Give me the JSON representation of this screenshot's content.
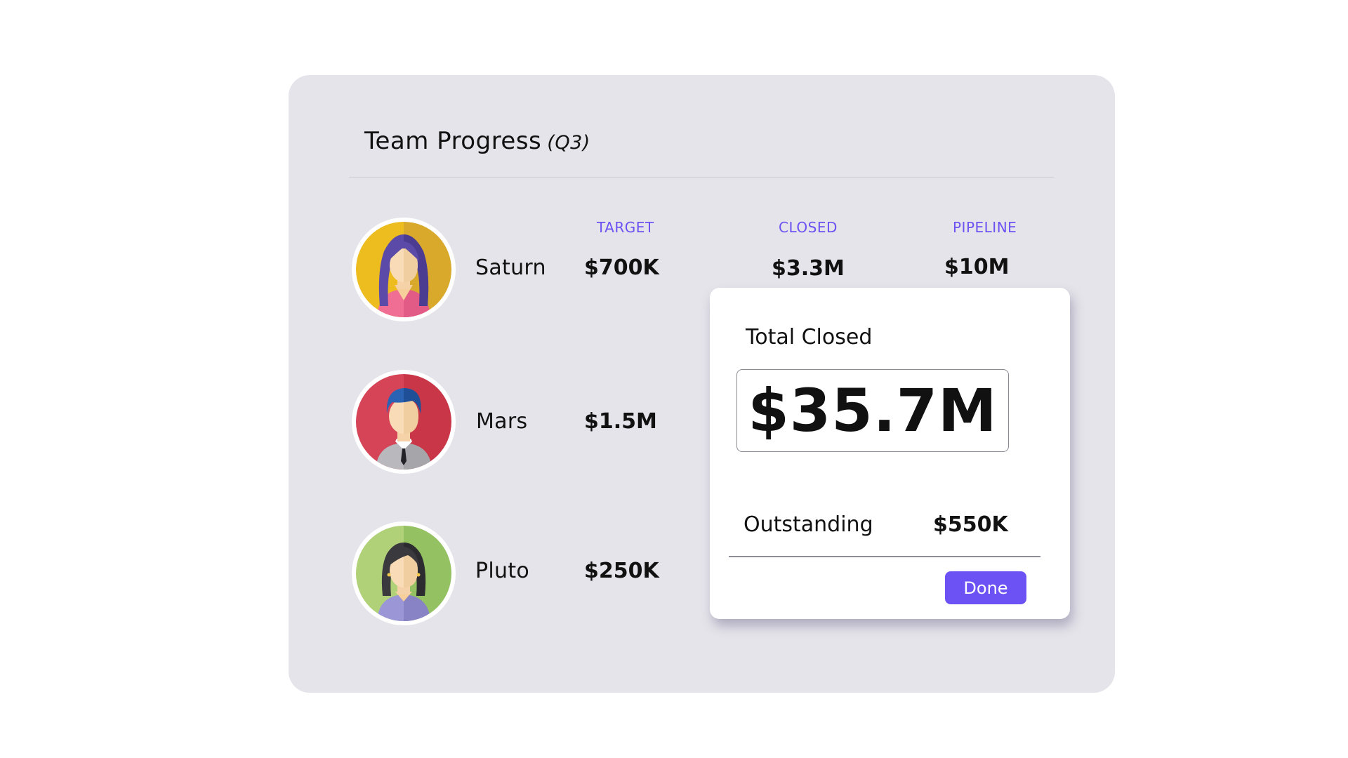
{
  "header": {
    "title": "Team Progress",
    "quarter": "(Q3)"
  },
  "columns": {
    "target": "TARGET",
    "closed": "CLOSED",
    "pipeline": "PIPELINE"
  },
  "members": [
    {
      "name": "Saturn",
      "target": "$700K",
      "closed": "$3.3M",
      "pipeline": "$10M",
      "avatar": "woman-avatar-icon",
      "avatar_color": "#e8b61e"
    },
    {
      "name": "Mars",
      "target": "$1.5M",
      "avatar": "man-avatar-icon",
      "avatar_color": "#d64457"
    },
    {
      "name": "Pluto",
      "target": "$250K",
      "avatar": "woman-avatar-icon",
      "avatar_color": "#a7cc6b"
    }
  ],
  "popover": {
    "title": "Total Closed",
    "total": "$35.7M",
    "outstanding_label": "Outstanding",
    "outstanding_value": "$550K",
    "done_label": "Done"
  },
  "colors": {
    "accent": "#6c52f5",
    "panel_bg": "#e5e4ea",
    "card_bg": "#ffffff"
  }
}
